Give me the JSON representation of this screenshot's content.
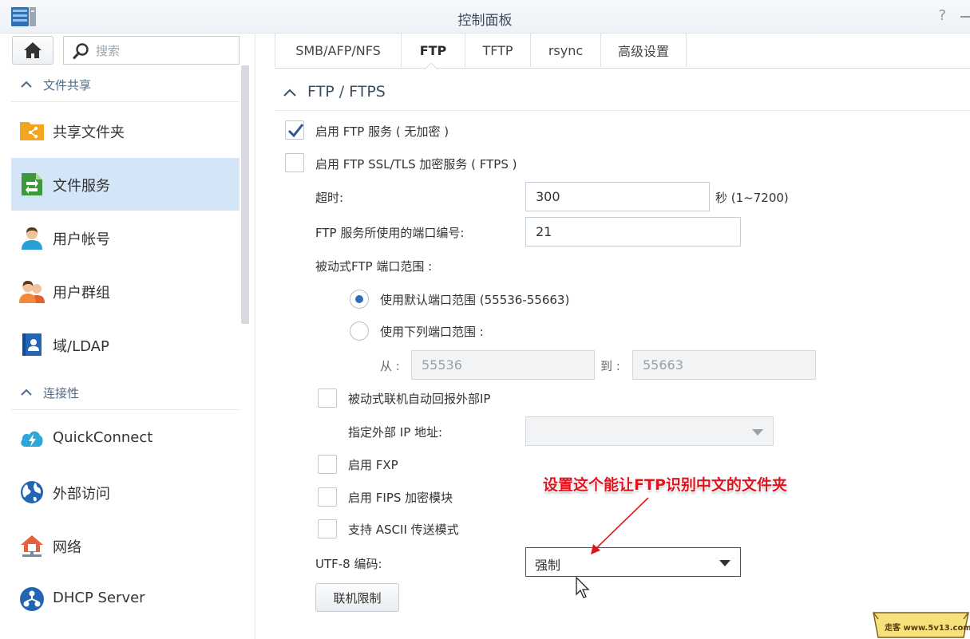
{
  "window": {
    "title": "控制面板"
  },
  "sidebar": {
    "search_placeholder": "搜索",
    "sections": [
      {
        "label": "文件共享"
      },
      {
        "label": "连接性"
      }
    ],
    "items": [
      {
        "label": "共享文件夹"
      },
      {
        "label": "文件服务"
      },
      {
        "label": "用户帐号"
      },
      {
        "label": "用户群组"
      },
      {
        "label": "域/LDAP"
      },
      {
        "label": "QuickConnect"
      },
      {
        "label": "外部访问"
      },
      {
        "label": "网络"
      },
      {
        "label": "DHCP Server"
      }
    ]
  },
  "tabs": [
    {
      "label": "SMB/AFP/NFS"
    },
    {
      "label": "FTP"
    },
    {
      "label": "TFTP"
    },
    {
      "label": "rsync"
    },
    {
      "label": "高级设置"
    }
  ],
  "ftp": {
    "section_title": "FTP / FTPS",
    "enable_ftp": {
      "label": "启用 FTP 服务 ( 无加密 )",
      "checked": true
    },
    "enable_ftps": {
      "label": "启用 FTP SSL/TLS 加密服务 ( FTPS )",
      "checked": false
    },
    "timeout": {
      "label": "超时:",
      "value": "300",
      "unit": "秒 (1~7200)"
    },
    "port": {
      "label": "FTP 服务所使用的端口编号:",
      "value": "21"
    },
    "passive_range_label": "被动式FTP 端口范围 :",
    "range_default": {
      "label": "使用默认端口范围 (55536-55663)",
      "selected": true
    },
    "range_custom": {
      "label": "使用下列端口范围 :",
      "selected": false
    },
    "from": {
      "label": "从 :",
      "value": "55536"
    },
    "to": {
      "label": "到 :",
      "value": "55663"
    },
    "report_external_ip": {
      "label": "被动式联机自动回报外部IP",
      "checked": false
    },
    "external_ip": {
      "label": "指定外部 IP 地址:",
      "value": ""
    },
    "enable_fxp": {
      "label": "启用 FXP",
      "checked": false
    },
    "enable_fips": {
      "label": "启用 FIPS 加密模块",
      "checked": false
    },
    "ascii_mode": {
      "label": "支持 ASCII 传送模式",
      "checked": false
    },
    "utf8": {
      "label": "UTF-8 编码:",
      "value": "强制"
    },
    "connection_limit_button": "联机限制"
  },
  "annotation": {
    "text": "设置这个能让FTP识别中文的文件夹"
  },
  "watermark": {
    "text": "走客 www.5v13.com"
  },
  "colors": {
    "accent": "#2d6fb7",
    "active_nav": "#d3e5f7",
    "annotation": "#e0141e"
  }
}
